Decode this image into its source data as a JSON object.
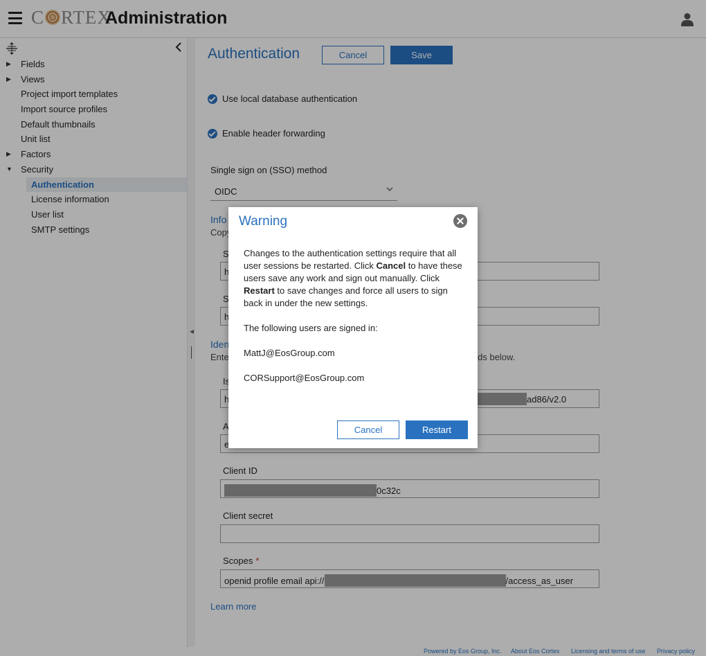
{
  "header": {
    "logo_text": "CORTEX",
    "logo_prefix": "C",
    "logo_suffix": "RTEX",
    "title": "Administration"
  },
  "sidebar": {
    "items": [
      {
        "label": "Fields",
        "expandable": true,
        "level": 1
      },
      {
        "label": "Views",
        "expandable": true,
        "level": 1
      },
      {
        "label": "Project import templates",
        "expandable": false,
        "level": 1
      },
      {
        "label": "Import source profiles",
        "expandable": false,
        "level": 1
      },
      {
        "label": "Default thumbnails",
        "expandable": false,
        "level": 1
      },
      {
        "label": "Unit list",
        "expandable": false,
        "level": 1
      },
      {
        "label": "Factors",
        "expandable": true,
        "level": 1
      },
      {
        "label": "Security",
        "expandable": true,
        "expanded": true,
        "level": 1
      },
      {
        "label": "Authentication",
        "level": 2,
        "active": true
      },
      {
        "label": "License information",
        "level": 2
      },
      {
        "label": "User list",
        "level": 2
      },
      {
        "label": "SMTP settings",
        "level": 2
      }
    ]
  },
  "main": {
    "title": "Authentication",
    "cancel_label": "Cancel",
    "save_label": "Save",
    "local_db_label": "Use local database authentication",
    "header_forwarding_label": "Enable header forwarding",
    "sso_label": "Single sign on (SSO) method",
    "sso_value": "OIDC",
    "info_title_partial": "Info",
    "info_sub_partial": "Copy",
    "field1_label_partial": "S",
    "field1_value_partial": "h",
    "field2_label_partial": "S",
    "field2_value_partial": "h",
    "identity_title_partial": "Iden",
    "identity_sub_partial": "Ente",
    "identity_sub_tail": "elds below.",
    "issuer_label_partial": "Is",
    "issuer_value_partial": "h",
    "issuer_value_tail": "ad86/v2.0",
    "auth_label_partial": "A",
    "auth_value_partial": "e",
    "client_id_label": "Client ID",
    "client_id_value_tail": "0c32c",
    "client_secret_label": "Client secret",
    "scopes_label": "Scopes",
    "scopes_required": "*",
    "scopes_value_prefix": "openid profile email api://",
    "scopes_value_suffix": "/access_as_user",
    "learn_more": "Learn more"
  },
  "dialog": {
    "title": "Warning",
    "p1_a": "Changes to the authentication settings require that all user sessions be restarted. Click ",
    "p1_b": "Cancel",
    "p1_c": " to have these users save any work and sign out manually. Click ",
    "p1_d": "Restart",
    "p1_e": " to save changes and force all users to sign back in under the new settings.",
    "p2": "The following users are signed in:",
    "users": [
      "MattJ@EosGroup.com",
      "CORSupport@EosGroup.com"
    ],
    "cancel_label": "Cancel",
    "restart_label": "Restart"
  },
  "footer": {
    "powered": "Powered by Eos Group, Inc.",
    "about": "About Eos Cortex",
    "licensing": "Licensing and terms of use",
    "privacy": "Privacy policy"
  },
  "colors": {
    "accent": "#2a72c0",
    "required": "#c0392b"
  }
}
